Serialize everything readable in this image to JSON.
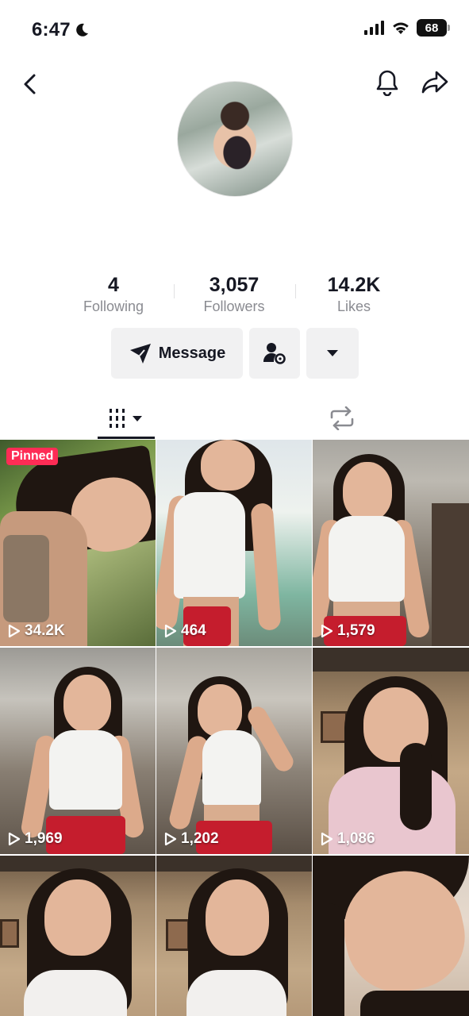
{
  "status_bar": {
    "time": "6:47",
    "battery": "68"
  },
  "stats": {
    "following": {
      "value": "4",
      "label": "Following"
    },
    "followers": {
      "value": "3,057",
      "label": "Followers"
    },
    "likes": {
      "value": "14.2K",
      "label": "Likes"
    }
  },
  "actions": {
    "message_label": "Message"
  },
  "tabs": [
    "videos",
    "reposts"
  ],
  "grid": {
    "pinned_label": "Pinned",
    "videos": [
      {
        "views": "34.2K",
        "pinned": true
      },
      {
        "views": "464"
      },
      {
        "views": "1,579"
      },
      {
        "views": "1,969"
      },
      {
        "views": "1,202"
      },
      {
        "views": "1,086"
      },
      {},
      {},
      {}
    ]
  },
  "colors": {
    "accent": "#fe2c55",
    "button_bg": "#f1f1f2",
    "text_primary": "#161823",
    "text_secondary": "#8a8b91"
  },
  "icons": [
    "moon-icon",
    "signal-icon",
    "wifi-icon",
    "battery-icon",
    "back-icon",
    "bell-icon",
    "share-icon",
    "message-send-icon",
    "add-friend-settings-icon",
    "caret-down-icon",
    "videos-grid-icon",
    "repost-icon",
    "play-icon"
  ]
}
